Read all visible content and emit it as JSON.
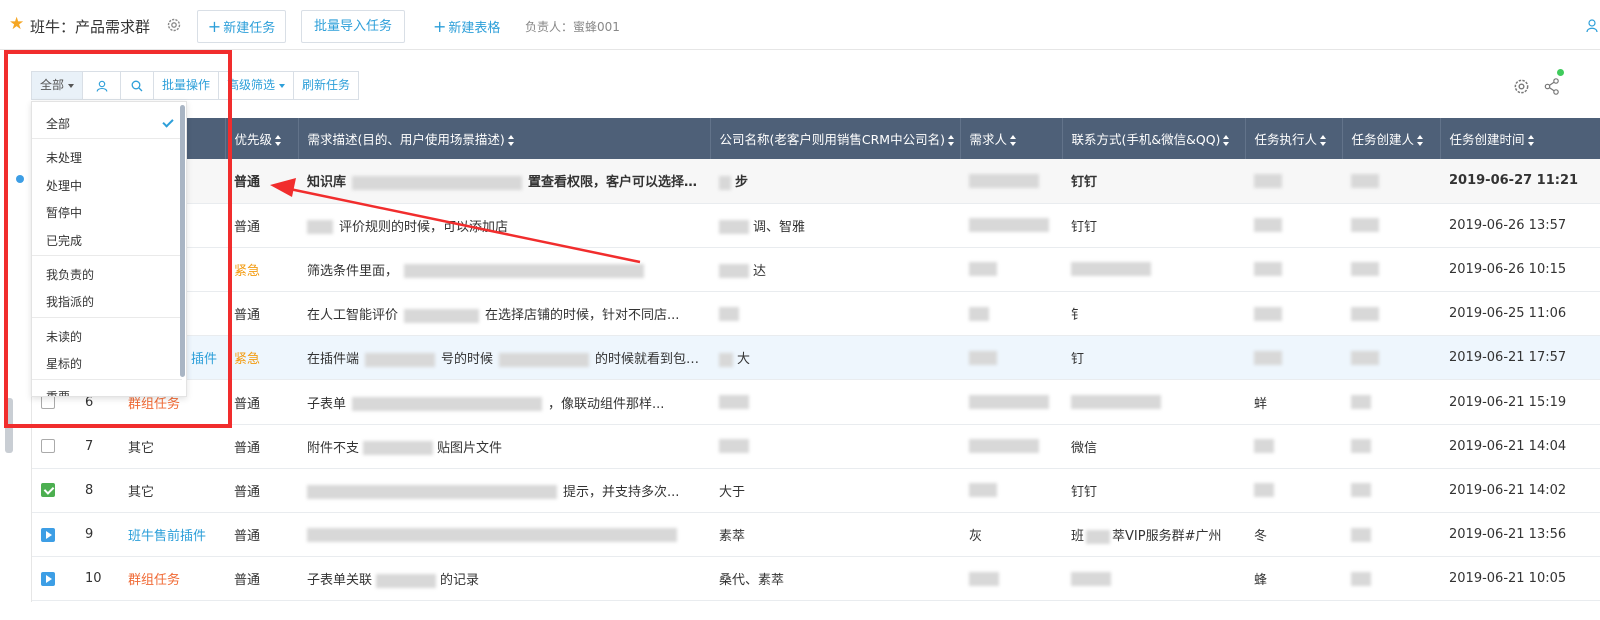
{
  "header": {
    "title": "班牛：产品需求群",
    "new_task": "新建任务",
    "batch_import": "批量导入任务",
    "new_table": "新建表格",
    "owner": "负责人：蜜蜂001"
  },
  "toolbar": {
    "filter_all": "全部",
    "batch_ops": "批量操作",
    "advanced_filter": "高级筛选",
    "refresh": "刷新任务"
  },
  "dropdown": {
    "items": [
      "全部",
      "未处理",
      "处理中",
      "暂停中",
      "已完成",
      "我负责的",
      "我指派的",
      "未读的",
      "星标的",
      "重要"
    ],
    "selected": "全部"
  },
  "table": {
    "headers": [
      "优先级",
      "需求描述(目的、用户使用场景描述)",
      "公司名称(老客户则用销售CRM中公司名)",
      "需求人",
      "联系方式(手机&微信&QQ)",
      "任务执行人",
      "任务创建人",
      "任务创建时间"
    ],
    "rows": [
      {
        "num": "",
        "type": "",
        "priority": "普通",
        "desc": "知识库",
        "desc2": "置查看权限，客户可以选择是...",
        "company": "步",
        "contact": "钉钉",
        "time": "2019-06-27 11:21"
      },
      {
        "num": "",
        "type": "",
        "priority": "普通",
        "desc": "评价规则的时候，可以添加店",
        "desc2": "",
        "company": "调、智雅",
        "contact": "钉钉",
        "time": "2019-06-26 13:57"
      },
      {
        "num": "",
        "type": "",
        "priority": "紧急",
        "desc": "筛选条件里面，",
        "desc2": "",
        "company": "达",
        "contact": "",
        "time": "2019-06-26 10:15"
      },
      {
        "num": "",
        "type": "",
        "priority": "普通",
        "desc": "在人工智能评价",
        "desc2": "在选择店铺的时候，针对不同店...",
        "company": "",
        "contact": "钅",
        "time": "2019-06-25 11:06"
      },
      {
        "num": "",
        "type": "插件",
        "priority": "紧急",
        "desc": "在插件端",
        "desc2": "的时候就看到包裹...",
        "company": "大",
        "contact": "钉",
        "time": "2019-06-21 17:57"
      },
      {
        "num": "6",
        "type": "群组任务",
        "priority": "普通",
        "desc": "子表单",
        "desc2": "，像联动组件那样...",
        "company": "",
        "contact": "",
        "time": "2019-06-21 15:19"
      },
      {
        "num": "7",
        "type": "其它",
        "priority": "普通",
        "desc": "附件不支",
        "desc2": "贴图片文件",
        "company": "",
        "contact": "微信",
        "time": "2019-06-21 14:04"
      },
      {
        "num": "8",
        "type": "其它",
        "priority": "普通",
        "desc": "",
        "desc2": "提示，并支持多次...",
        "company": "大于",
        "contact": "钉钉",
        "time": "2019-06-21 14:02"
      },
      {
        "num": "9",
        "type": "班牛售前插件",
        "priority": "普通",
        "desc": "",
        "desc2": "",
        "company": "素萃",
        "contact": "萃VIP服务群#广州",
        "time": "2019-06-21 13:56"
      },
      {
        "num": "10",
        "type": "群组任务",
        "priority": "普通",
        "desc": "子表单关联",
        "desc2": "的记录",
        "company": "桑代、素萃",
        "contact": "",
        "time": "2019-06-21 10:05"
      }
    ]
  },
  "row_labels": {
    "assignee_9": "冬",
    "assignee_6": "蛘",
    "assignee_10": "蜂",
    "req_row9": "灰"
  },
  "colors": {
    "accent": "#2d9fd9",
    "header_bg": "#4e6078",
    "urgent": "#f39c12",
    "annotation": "#f12d2d"
  }
}
